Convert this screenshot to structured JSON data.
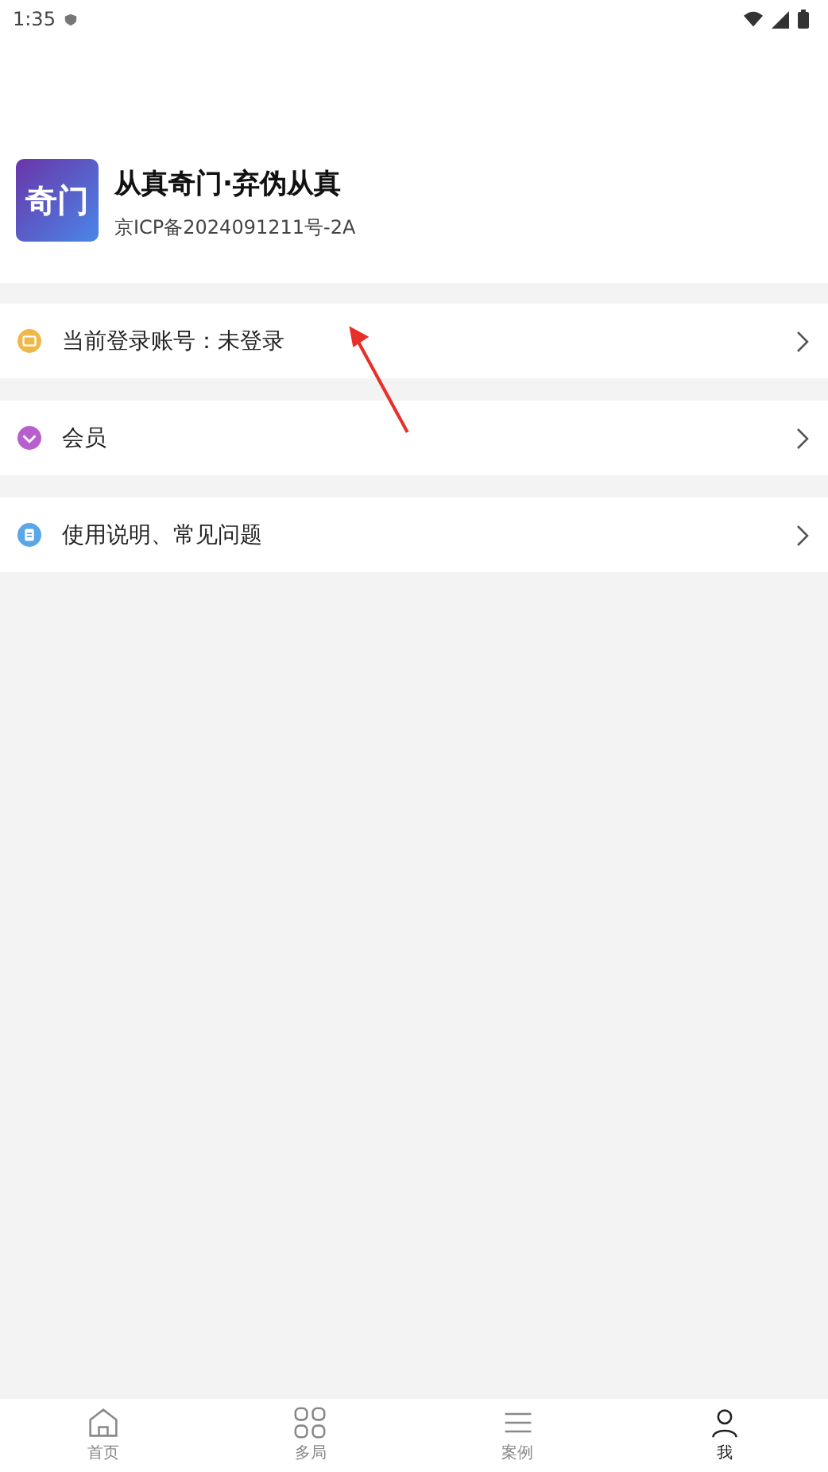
{
  "status_bar": {
    "time": "1:35"
  },
  "profile": {
    "title": "从真奇门·弃伪从真",
    "subtitle": "京ICP备2024091211号-2A",
    "logo_text": "奇门"
  },
  "menu": [
    {
      "kind": "account",
      "label": "当前登录账号：未登录",
      "color": "#f0b84a"
    },
    {
      "kind": "member",
      "label": "会员",
      "color": "#b85fd0"
    },
    {
      "kind": "help",
      "label": "使用说明、常见问题",
      "color": "#5aa7e8"
    }
  ],
  "tab_bar": [
    {
      "kind": "home",
      "label": "首页",
      "selected": false
    },
    {
      "kind": "grid",
      "label": "多局",
      "selected": false
    },
    {
      "kind": "list",
      "label": "案例",
      "selected": false
    },
    {
      "kind": "me",
      "label": "我",
      "selected": true
    }
  ]
}
